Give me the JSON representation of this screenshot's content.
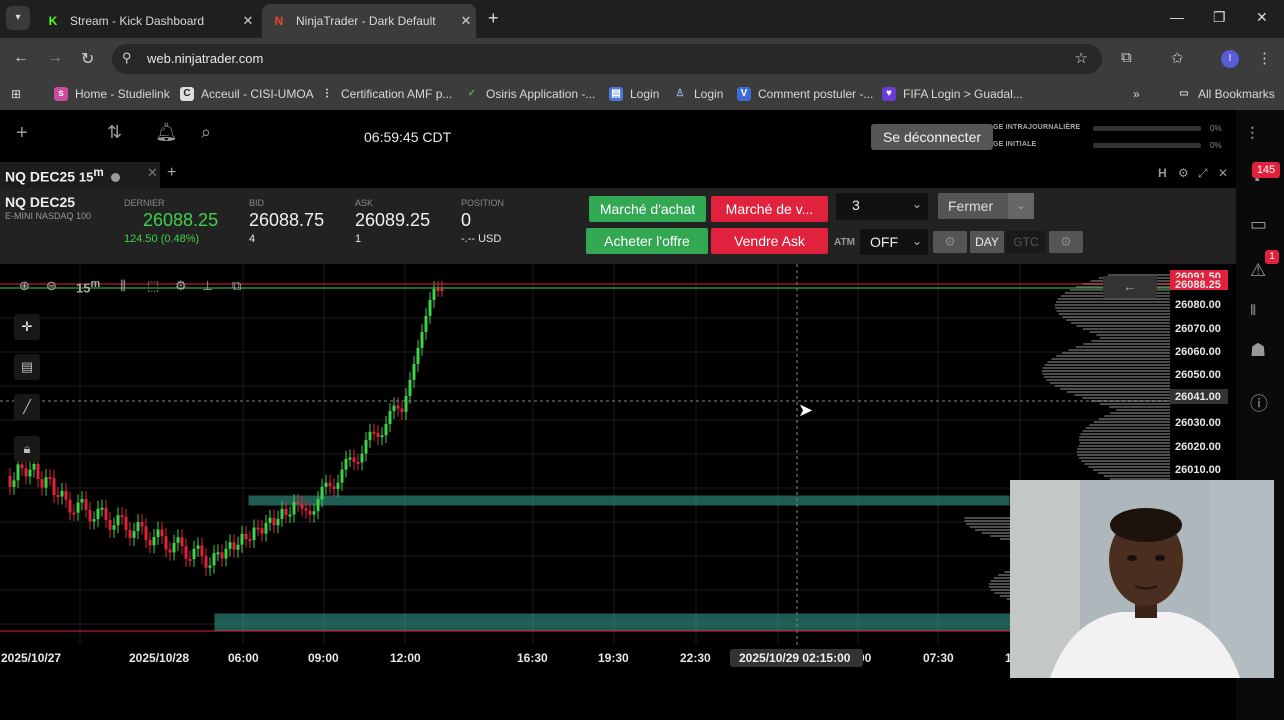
{
  "browser": {
    "tabs": [
      {
        "title": "Stream - Kick Dashboard",
        "active": false,
        "icon": "kick-icon"
      },
      {
        "title": "NinjaTrader - Dark Default",
        "active": true,
        "icon": "ninjatrader-icon"
      }
    ],
    "url": "web.ninjatrader.com",
    "profile_initial": "I",
    "bookmarks": [
      {
        "label": "Home - Studielink",
        "icon": "studielink-icon",
        "color": "#cc4b9b"
      },
      {
        "label": "Acceuil - CISI-UMOA",
        "icon": "cisi-icon",
        "color": "#d9d9d9"
      },
      {
        "label": "Certification AMF p...",
        "icon": "amf-icon",
        "color": "#3c3c3c"
      },
      {
        "label": "Osiris Application -...",
        "icon": "osiris-icon",
        "color": "#3c3c3c"
      },
      {
        "label": "Login",
        "icon": "login-doc-icon",
        "color": "#4a7bd6"
      },
      {
        "label": "Login",
        "icon": "login-user-icon",
        "color": "#3c3c3c"
      },
      {
        "label": "Comment postuler -...",
        "icon": "v-icon",
        "color": "#3c6bd6"
      },
      {
        "label": "FIFA Login > Guadal...",
        "icon": "fifa-icon",
        "color": "#6b3cd6"
      }
    ],
    "all_bookmarks_label": "All Bookmarks"
  },
  "platform": {
    "clock": "06:59:45 CDT",
    "logout_label": "Se déconnecter",
    "account_rows": [
      {
        "label": "GE INTRAJOURNALIÈRE",
        "pct": "0%"
      },
      {
        "label": "GE INITIALE",
        "pct": "0%"
      }
    ],
    "rail": {
      "badge_top": "145",
      "badge_alert": "1"
    }
  },
  "chart_tab": {
    "symbol": "NQ DEC25",
    "timeframe": "15",
    "timeframe_unit": "m",
    "header_tools": [
      "H",
      "⚙",
      "⤢",
      "✕"
    ]
  },
  "quote": {
    "symbol": "NQ DEC25",
    "description": "E-MINI NASDAQ 100",
    "last_label": "DERNIER",
    "last": "26088.25",
    "change": "124.50 (0.48%)",
    "bid_label": "BID",
    "bid": "26088.75",
    "bid_size": "4",
    "ask_label": "ASK",
    "ask": "26089.25",
    "ask_size": "1",
    "position_label": "POSITION",
    "position": "0",
    "position_pnl": "-.-- USD"
  },
  "order_entry": {
    "market_buy": "Marché d'achat",
    "market_sell": "Marché de v...",
    "buy_bid": "Acheter l'offre",
    "sell_ask": "Vendre Ask",
    "quantity": "3",
    "close_label": "Fermer",
    "atm_label": "ATM",
    "atm_value": "OFF",
    "tif_day": "DAY",
    "tif_gtc": "GTC"
  },
  "chart_toolbar": {
    "timeframe": "15",
    "timeframe_unit": "m"
  },
  "chart": {
    "colors": {
      "up": "#3fd14a",
      "down": "#e0223d",
      "zone": "#3aa89a",
      "grid": "#1c1c1c"
    },
    "price_labels": [
      {
        "text": "26091.50",
        "kind": "ask-tag"
      },
      {
        "text": "26088.25",
        "kind": "last-tag"
      },
      {
        "text": "26080.00"
      },
      {
        "text": "26070.00"
      },
      {
        "text": "26060.00"
      },
      {
        "text": "26050.00"
      },
      {
        "text": "26041.00",
        "kind": "cursor-tag"
      },
      {
        "text": "26030.00"
      },
      {
        "text": "26020.00"
      },
      {
        "text": "26010.00"
      }
    ],
    "time_labels": [
      "2025/10/27",
      "2025/10/28",
      "06:00",
      "09:00",
      "12:00",
      "16:30",
      "19:30",
      "22:30",
      "00",
      "07:30",
      "1"
    ],
    "cursor_time": "2025/10/29 02:15:00"
  }
}
